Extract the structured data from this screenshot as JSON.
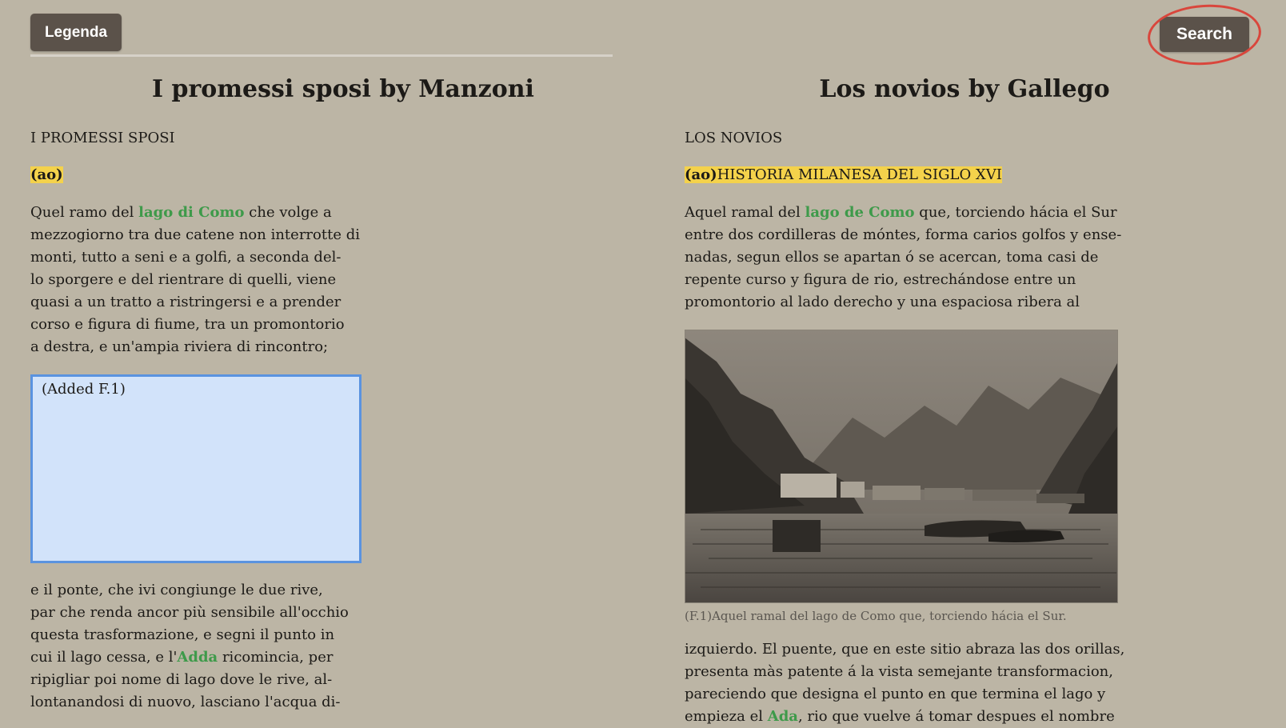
{
  "toolbar": {
    "legend_label": "Legenda",
    "search_label": "Search"
  },
  "left": {
    "title": "I promessi sposi by Manzoni",
    "book_title": "I PROMESSI SPOSI",
    "chapter_marker": "(ao)",
    "p1_before": "Quel ramo del ",
    "p1_link": "lago di Como",
    "p1_after": " che volge a\nmezzogiorno tra due catene non interrotte di\nmonti, tutto a seni e a golfi, a seconda del-\nlo sporgere e del rientrare di quelli, viene\nquasi a un tratto a ristringersi e a prender\ncorso e figura di fiume, tra un promontorio\na destra, e un'ampia riviera di rincontro;",
    "added_box": "(Added F.1)",
    "p2_before": "e il ponte, che ivi congiunge le due rive,\npar che renda ancor più sensibile all'occhio\nquesta trasformazione, e segni il punto in\ncui il lago cessa, e l'",
    "p2_link": "Adda",
    "p2_after": " ricomincia, per\nripigliar poi nome di lago dove le rive, al-\nlontanandosi di nuovo, lasciano l'acqua di-"
  },
  "right": {
    "title": "Los novios by Gallego",
    "book_title": "LOS NOVIOS",
    "chapter_marker": "(ao)",
    "chapter_title": "HISTORIA MILANESA DEL SIGLO XVI",
    "p1_before": "Aquel ramal del ",
    "p1_link": "lago de Como",
    "p1_after": " que, torciendo hácia el Sur\nentre dos cordilleras de móntes, forma carios golfos y ense-\nnadas, segun ellos se apartan ó se acercan, toma casi de\nrepente curso y figura de rio, estrechándose entre un\npromontorio al lado derecho y una espaciosa ribera al",
    "figure_caption": "(F.1)Aquel ramal del lago de Como que, torciendo hácia el Sur.",
    "p2_text": "izquierdo. El puente, que en este sitio abraza las dos orillas,\npresenta màs patente á la vista semejante transformacion,\npareciendo que designa el punto en que termina el lago y\nempieza el ",
    "p2_link": "Ada",
    "p2_after": ", rio que vuelve á tomar despues el nombre"
  }
}
